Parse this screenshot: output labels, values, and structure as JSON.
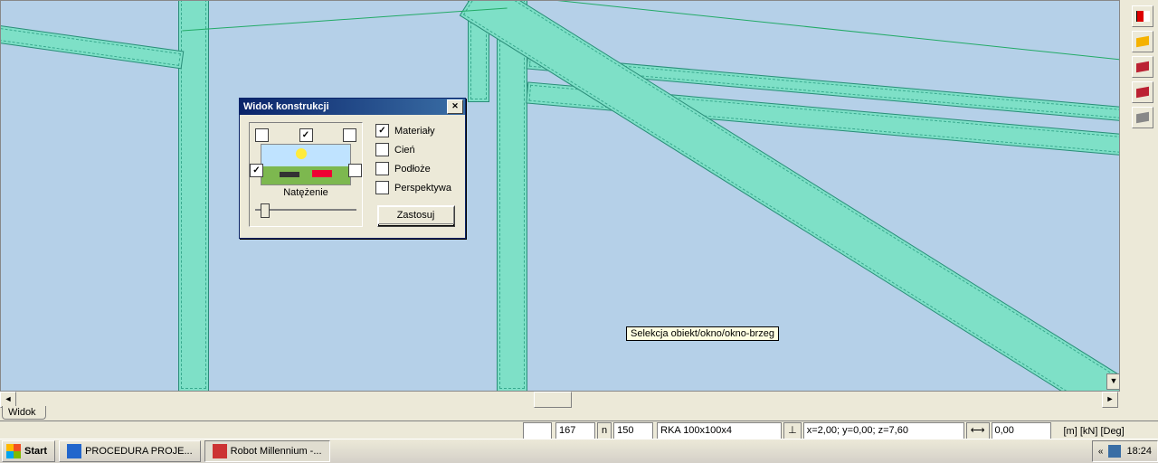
{
  "dialog": {
    "title": "Widok konstrukcji",
    "intensity_label": "Natężenie",
    "options": {
      "materials": "Materiały",
      "shadow": "Cień",
      "ground": "Podłoże",
      "perspective": "Perspektywa"
    },
    "apply": "Zastosuj"
  },
  "tooltip": "Selekcja obiekt/okno/okno-brzeg",
  "tab": "Widok",
  "status": {
    "field1": "",
    "field2": "167",
    "btn_n": "n",
    "field3": "150",
    "field4": "RKA 100x100x4",
    "coord_icon": "⊥",
    "coords": "x=2,00; y=0,00; z=7,60",
    "dim_icon": "⟷",
    "dim": "0,00",
    "units": "[m] [kN] [Deg]"
  },
  "taskbar": {
    "start": "Start",
    "app1": "PROCEDURA PROJE...",
    "app2": "Robot Millennium -...",
    "tray_chev": "«",
    "clock": "18:24"
  }
}
